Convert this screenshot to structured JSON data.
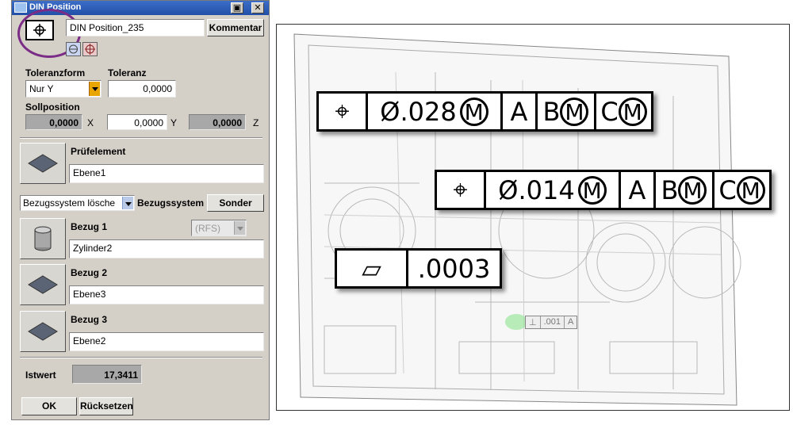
{
  "window": {
    "title": "DIN Position"
  },
  "header": {
    "name_value": "DIN Position_235",
    "comment_label": "Kommentar"
  },
  "tolerance": {
    "form_label": "Toleranzform",
    "form_value": "Nur Y",
    "tol_label": "Toleranz",
    "tol_value": "0,0000"
  },
  "nominal": {
    "label": "Sollposition",
    "x_value": "0,0000",
    "x_label": "X",
    "y_value": "0,0000",
    "y_label": "Y",
    "z_value": "0,0000",
    "z_label": "Z"
  },
  "feature": {
    "label": "Prüfelement",
    "value": "Ebene1"
  },
  "datum_system": {
    "dropdown_value": "Bezugssystem lösche",
    "label": "Bezugssystem",
    "special_label": "Sonder"
  },
  "datums": [
    {
      "label": "Bezug 1",
      "value": "Zylinder2",
      "modifier": "(RFS)"
    },
    {
      "label": "Bezug 2",
      "value": "Ebene3"
    },
    {
      "label": "Bezug 3",
      "value": "Ebene2"
    }
  ],
  "actual": {
    "label": "Istwert",
    "value": "17,3411"
  },
  "buttons": {
    "ok": "OK",
    "reset": "Rücksetzen"
  },
  "frames": [
    {
      "symbol": "⌖",
      "value": "Ø.028",
      "mmc": "M",
      "datum_a": "A",
      "datum_b": "B",
      "datum_c": "C"
    },
    {
      "symbol": "⌖",
      "value": "Ø.014",
      "mmc": "M",
      "datum_a": "A",
      "datum_b": "B",
      "datum_c": "C"
    },
    {
      "symbol": "▱",
      "value": ".0003"
    }
  ],
  "small_tag": {
    "symbol": "⊥",
    "value": ".001",
    "datum": "A"
  },
  "colors": {
    "highlight_ring": "#7a2c86",
    "titlebar": "#2a5bb8"
  }
}
